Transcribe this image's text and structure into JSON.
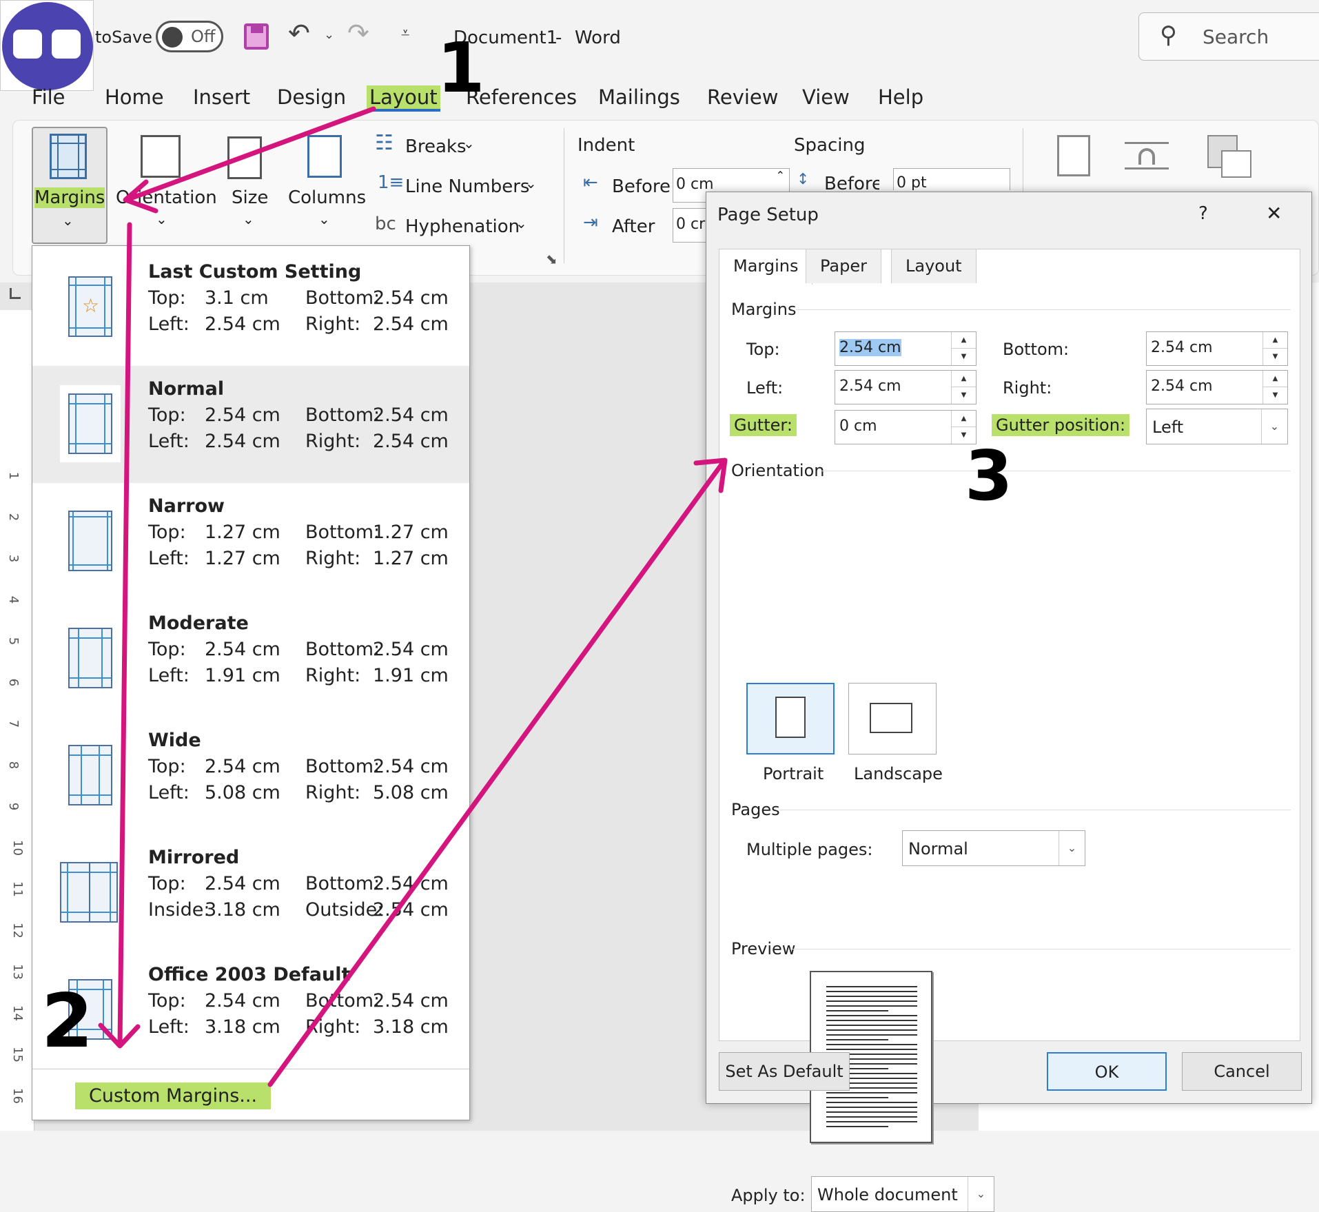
{
  "titlebar": {
    "autosave_label": "toSave",
    "toggle_state": "Off",
    "document_title": "Document1",
    "separator": "-",
    "app_name": "Word",
    "search_placeholder": "Search"
  },
  "tabs": [
    "File",
    "Home",
    "Insert",
    "Design",
    "Layout",
    "References",
    "Mailings",
    "Review",
    "View",
    "Help"
  ],
  "ribbon": {
    "margins": "Margins",
    "orientation": "Orientation",
    "size": "Size",
    "columns": "Columns",
    "breaks": "Breaks",
    "line_numbers": "Line Numbers",
    "hyphenation": "Hyphenation",
    "indent": "Indent",
    "spacing": "Spacing",
    "before": "Before",
    "after": "After",
    "indent_before_value": "0 cm",
    "indent_after_value": "0 cr",
    "spacing_before_label": "Before:",
    "spacing_before_value": "0 pt"
  },
  "margins_menu": {
    "items": [
      {
        "name": "Last Custom Setting",
        "top": "3.1 cm",
        "bottom": "2.54 cm",
        "left_label": "Left:",
        "left": "2.54 cm",
        "right_label": "Right:",
        "right": "2.54 cm"
      },
      {
        "name": "Normal",
        "top": "2.54 cm",
        "bottom": "2.54 cm",
        "left_label": "Left:",
        "left": "2.54 cm",
        "right_label": "Right:",
        "right": "2.54 cm"
      },
      {
        "name": "Narrow",
        "top": "1.27 cm",
        "bottom": "1.27 cm",
        "left_label": "Left:",
        "left": "1.27 cm",
        "right_label": "Right:",
        "right": "1.27 cm"
      },
      {
        "name": "Moderate",
        "top": "2.54 cm",
        "bottom": "2.54 cm",
        "left_label": "Left:",
        "left": "1.91 cm",
        "right_label": "Right:",
        "right": "1.91 cm"
      },
      {
        "name": "Wide",
        "top": "2.54 cm",
        "bottom": "2.54 cm",
        "left_label": "Left:",
        "left": "5.08 cm",
        "right_label": "Right:",
        "right": "5.08 cm"
      },
      {
        "name": "Mirrored",
        "top": "2.54 cm",
        "bottom": "2.54 cm",
        "left_label": "Inside:",
        "left": "3.18 cm",
        "right_label": "Outside:",
        "right": "2.54 cm"
      },
      {
        "name": "Office 2003 Default",
        "top": "2.54 cm",
        "bottom": "2.54 cm",
        "left_label": "Left:",
        "left": "3.18 cm",
        "right_label": "Right:",
        "right": "3.18 cm"
      }
    ],
    "top_label": "Top:",
    "bottom_label": "Bottom:",
    "custom": "Custom Margins..."
  },
  "dialog": {
    "title": "Page Setup",
    "help": "?",
    "close": "✕",
    "tabs": [
      "Margins",
      "Paper",
      "Layout"
    ],
    "margins_section": "Margins",
    "top_label": "Top:",
    "top_value": "2.54 cm",
    "bottom_label": "Bottom:",
    "bottom_value": "2.54 cm",
    "left_label": "Left:",
    "left_value": "2.54 cm",
    "right_label": "Right:",
    "right_value": "2.54 cm",
    "gutter_label": "Gutter:",
    "gutter_value": "0 cm",
    "gutter_pos_label": "Gutter position:",
    "gutter_pos_value": "Left",
    "orientation_section": "Orientation",
    "portrait": "Portrait",
    "landscape": "Landscape",
    "pages_section": "Pages",
    "multiple_pages_label": "Multiple pages:",
    "multiple_pages_value": "Normal",
    "preview_section": "Preview",
    "apply_to_label": "Apply to:",
    "apply_to_value": "Whole document",
    "set_default": "Set As Default",
    "ok": "OK",
    "cancel": "Cancel"
  },
  "annotations": {
    "step1": "1",
    "step2": "2",
    "step3": "3"
  },
  "ruler_numbers": [
    "1",
    "2",
    "3",
    "4",
    "5",
    "6",
    "7",
    "8",
    "9",
    "10",
    "11",
    "12",
    "13",
    "14",
    "15",
    "16"
  ],
  "colors": {
    "highlight": "#b8e06a",
    "arrow": "#d4157d",
    "accent": "#2b7cd3"
  }
}
